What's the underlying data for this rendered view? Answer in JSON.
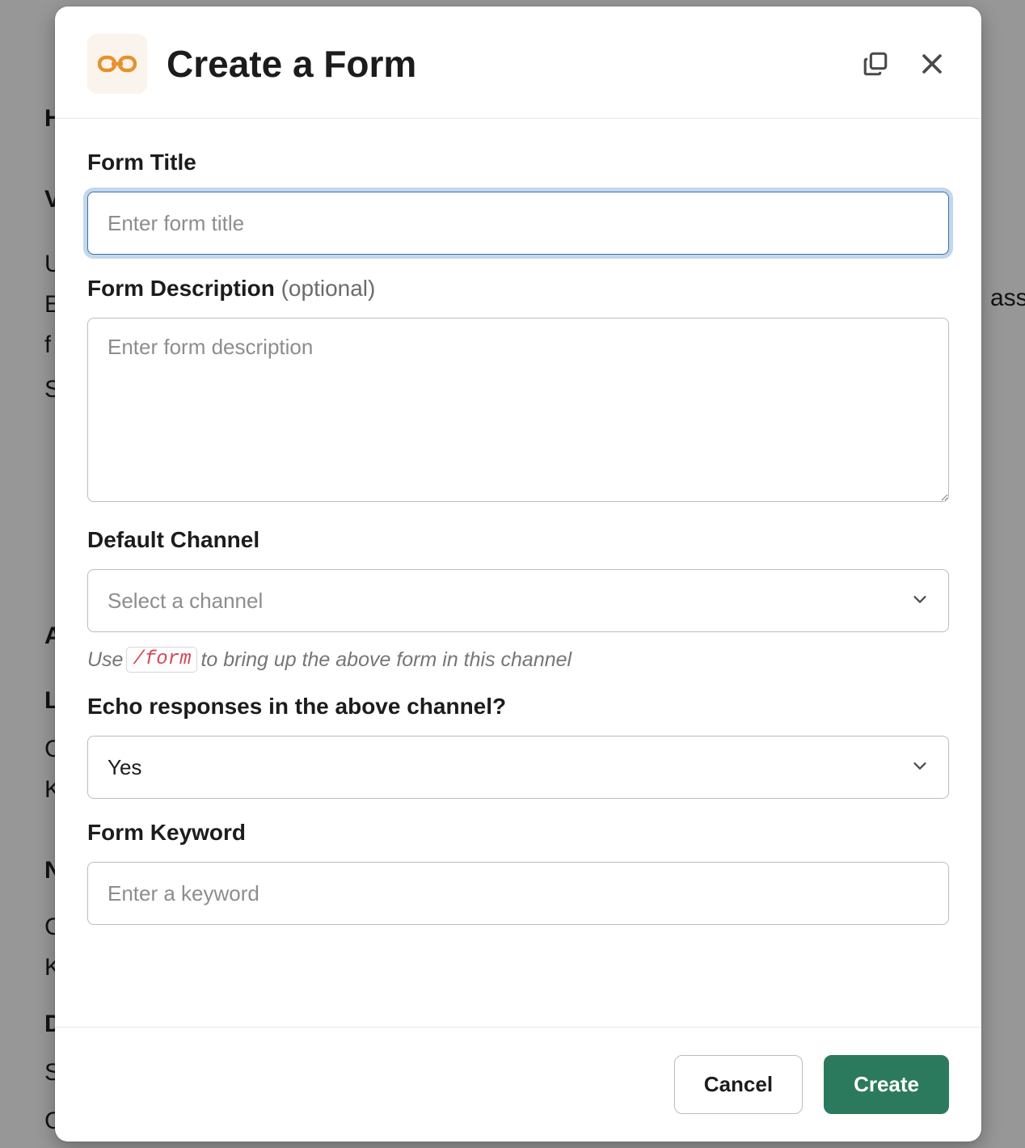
{
  "modal": {
    "title": "Create a Form",
    "cancel_label": "Cancel",
    "create_label": "Create"
  },
  "fields": {
    "title": {
      "label": "Form Title",
      "placeholder": "Enter form title",
      "value": ""
    },
    "description": {
      "label": "Form Description",
      "optional_text": "(optional)",
      "placeholder": "Enter form description",
      "value": ""
    },
    "channel": {
      "label": "Default Channel",
      "placeholder": "Select a channel",
      "hint_prefix": "Use",
      "hint_command": "/form",
      "hint_suffix": "to bring up the above form in this channel"
    },
    "echo": {
      "label": "Echo responses in the above channel?",
      "value": "Yes"
    },
    "keyword": {
      "label": "Form Keyword",
      "placeholder": "Enter a keyword",
      "value": ""
    }
  }
}
